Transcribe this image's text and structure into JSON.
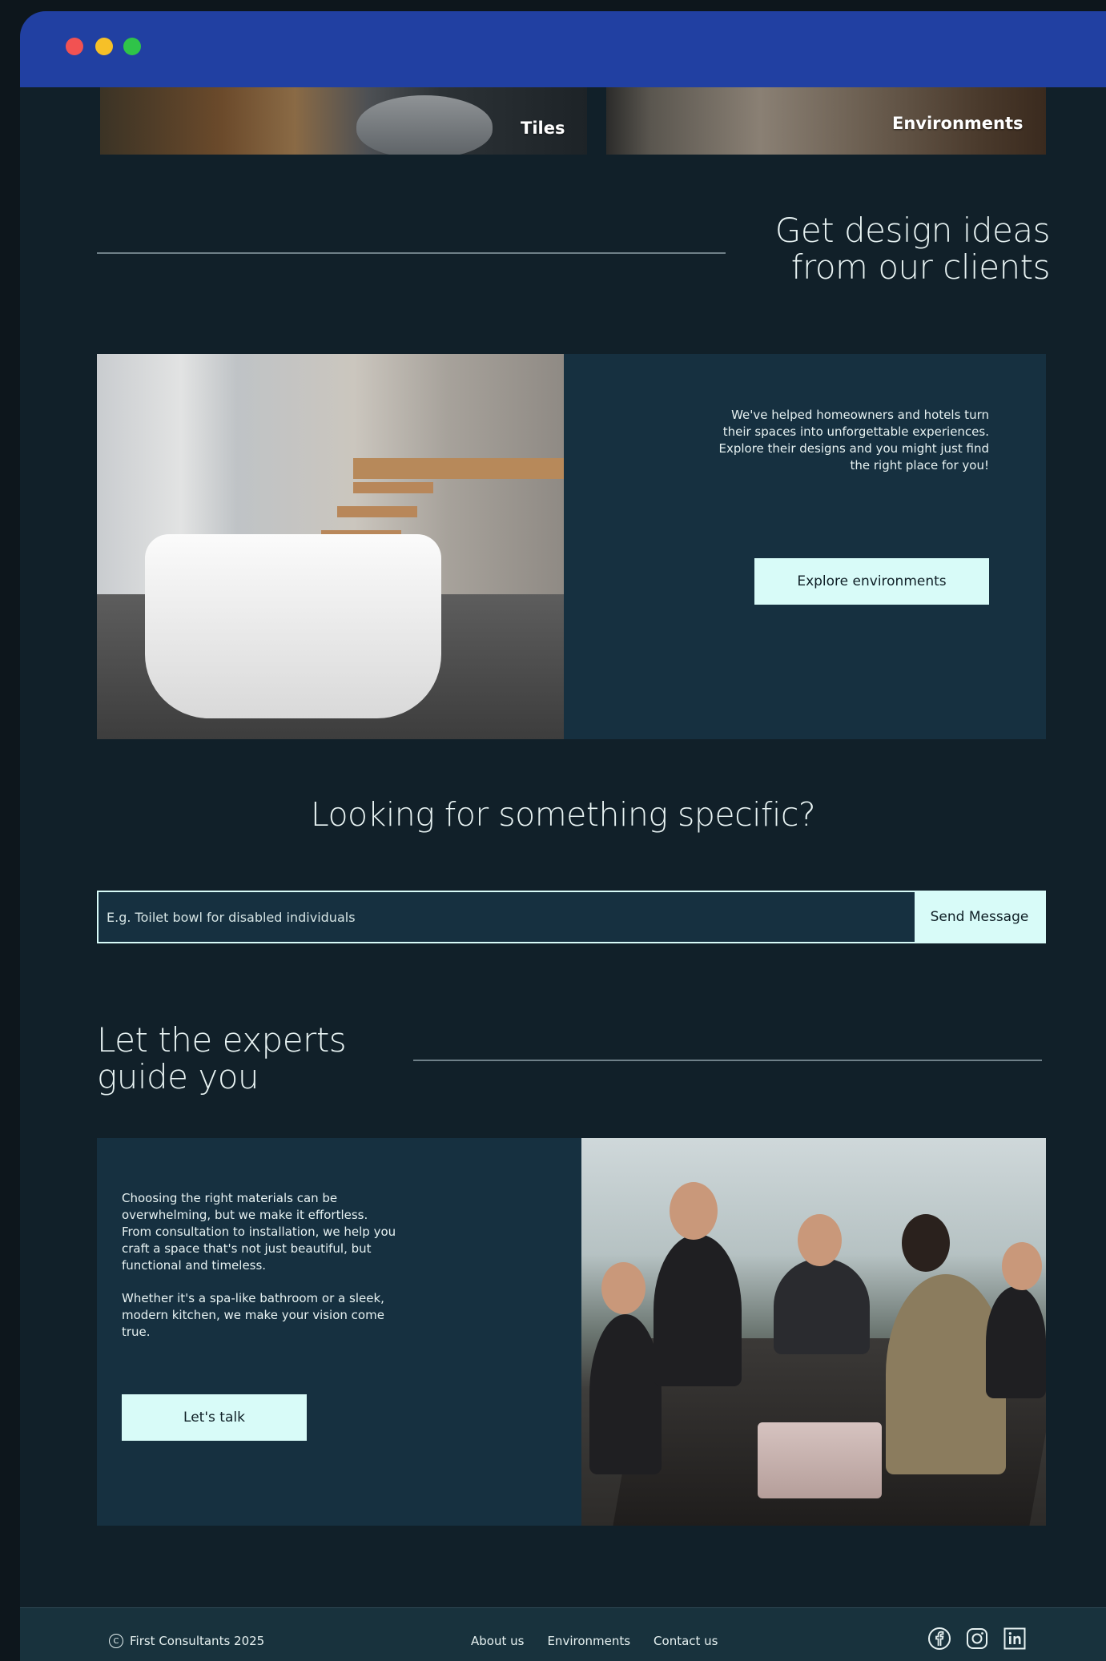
{
  "window": {
    "controls": [
      "close",
      "minimize",
      "maximize"
    ]
  },
  "categories": {
    "tiles_label": "Tiles",
    "environments_label": "Environments"
  },
  "clients_section": {
    "title_line1": "Get design ideas",
    "title_line2": "from our clients",
    "description": "We've helped homeowners and hotels turn their spaces into unforgettable experiences. Explore their designs and you might just find the right place for you!",
    "cta_label": "Explore environments"
  },
  "search_section": {
    "title": "Looking for something specific?",
    "placeholder": "E.g. Toilet bowl for disabled individuals",
    "button_label": "Send Message"
  },
  "experts_section": {
    "title_line1": "Let the experts",
    "title_line2": "guide you",
    "paragraph1": "Choosing the right materials can be overwhelming, but we make it effortless. From consultation to installation, we help you craft a space that's not just beautiful, but functional and timeless.",
    "paragraph2": "Whether it's a spa-like bathroom or a sleek, modern kitchen, we make your vision come true.",
    "cta_label": "Let's talk"
  },
  "footer": {
    "copyright": "First Consultants 2025",
    "nav": [
      "About us",
      "Environments",
      "Contact us"
    ],
    "social_icons": [
      "facebook-icon",
      "instagram-icon",
      "linkedin-icon"
    ]
  },
  "colors": {
    "background": "#112029",
    "panel": "#163040",
    "titlebar": "#2140a2",
    "accent": "#d8fbf8"
  }
}
